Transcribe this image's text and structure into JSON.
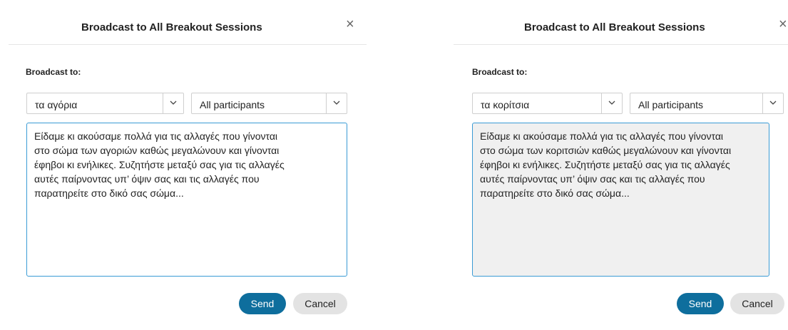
{
  "left": {
    "title": "Broadcast to All Breakout Sessions",
    "close_glyph": "×",
    "broadcast_label": "Broadcast to:",
    "session_select": "τα αγόρια",
    "audience_select": "All participants",
    "message": "Είδαμε κι ακούσαμε πολλά για τις αλλαγές που γίνονται\nστο σώμα των αγοριών καθώς μεγαλώνουν και γίνονται\nέφηβοι κι ενήλικες. Συζητήστε μεταξύ σας για τις αλλαγές\nαυτές παίρνοντας υπ’ όψιν σας και τις αλλαγές που\nπαρατηρείτε στο δικό σας σώμα...",
    "send_label": "Send",
    "cancel_label": "Cancel"
  },
  "right": {
    "title": "Broadcast to All Breakout Sessions",
    "close_glyph": "×",
    "broadcast_label": "Broadcast to:",
    "session_select": "τα κορίτσια",
    "audience_select": "All participants",
    "message": "Είδαμε κι ακούσαμε πολλά για τις αλλαγές που γίνονται\nστο σώμα των κοριτσιών καθώς μεγαλώνουν και γίνονται\nέφηβοι κι ενήλικες. Συζητήστε μεταξύ σας για τις αλλαγές\nαυτές παίρνοντας υπ’ όψιν σας και τις αλλαγές που\nπαρατηρείτε στο δικό σας σώμα...",
    "send_label": "Send",
    "cancel_label": "Cancel"
  },
  "colors": {
    "send_button": "#0e6e9d",
    "cancel_button": "#e3e3e3",
    "focus_border": "#3a9bd5",
    "disabled_textarea": "#f0f0f0"
  },
  "icons": {
    "close": "close-icon",
    "dropdown": "chevron-down-icon"
  }
}
